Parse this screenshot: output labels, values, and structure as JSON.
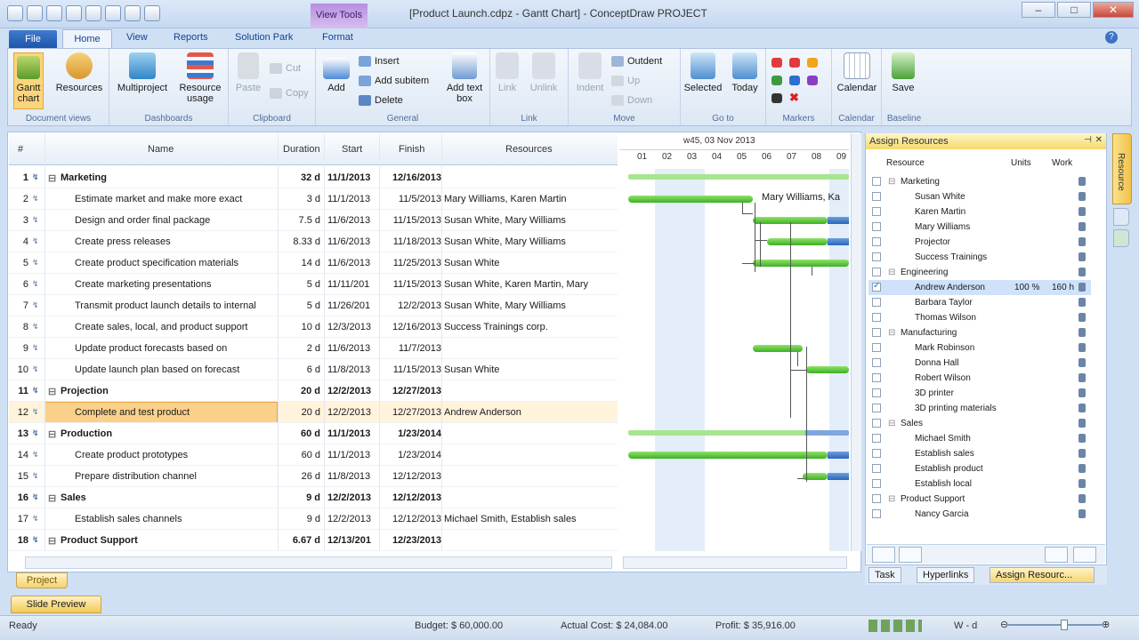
{
  "title_bar": {
    "title": "[Product Launch.cdpz - Gantt Chart] - ConceptDraw PROJECT",
    "context_tab": "View Tools",
    "min": "–",
    "max": "□",
    "close": "✕"
  },
  "tabs": {
    "file": "File",
    "home": "Home",
    "view": "View",
    "reports": "Reports",
    "solution_park": "Solution Park",
    "format": "Format"
  },
  "ribbon": {
    "document_views": {
      "label": "Document views",
      "gantt": "Gantt\nchart",
      "resources": "Resources"
    },
    "dashboards": {
      "label": "Dashboards",
      "multiproject": "Multiproject",
      "resource_usage": "Resource\nusage"
    },
    "clipboard": {
      "label": "Clipboard",
      "paste": "Paste",
      "cut": "Cut",
      "copy": "Copy"
    },
    "general": {
      "label": "General",
      "add": "Add",
      "insert": "Insert",
      "add_subitem": "Add subitem",
      "delete": "Delete",
      "add_text_box": "Add text\nbox"
    },
    "link": {
      "label": "Link",
      "link": "Link",
      "unlink": "Unlink"
    },
    "move": {
      "label": "Move",
      "indent": "Indent",
      "outdent": "Outdent",
      "up": "Up",
      "down": "Down"
    },
    "goto": {
      "label": "Go to",
      "selected": "Selected",
      "today": "Today"
    },
    "markers": {
      "label": "Markers"
    },
    "calendar": {
      "label": "Calendar",
      "calendar": "Calendar"
    },
    "baseline": {
      "label": "Baseline",
      "save": "Save"
    }
  },
  "grid": {
    "headers": {
      "num": "#",
      "name": "Name",
      "duration": "Duration",
      "start": "Start",
      "finish": "Finish",
      "resources": "Resources"
    },
    "rows": [
      {
        "n": "1",
        "name": "Marketing",
        "dur": "32 d",
        "start": "11/1/2013",
        "finish": "12/16/2013",
        "res": "",
        "summary": true
      },
      {
        "n": "2",
        "name": "Estimate market and make more exact",
        "dur": "3 d",
        "start": "11/1/2013",
        "finish": "11/5/2013",
        "res": "Mary Williams, Karen Martin"
      },
      {
        "n": "3",
        "name": "Design and order final package",
        "dur": "7.5 d",
        "start": "11/6/2013",
        "finish": "11/15/2013",
        "res": "Susan White, Mary Williams"
      },
      {
        "n": "4",
        "name": "Create press releases",
        "dur": "8.33 d",
        "start": "11/6/2013",
        "finish": "11/18/2013",
        "res": "Susan White, Mary Williams"
      },
      {
        "n": "5",
        "name": "Create product specification materials",
        "dur": "14 d",
        "start": "11/6/2013",
        "finish": "11/25/2013",
        "res": "Susan White"
      },
      {
        "n": "6",
        "name": "Create marketing presentations",
        "dur": "5 d",
        "start": "11/11/201",
        "finish": "11/15/2013",
        "res": "Susan White, Karen Martin, Mary"
      },
      {
        "n": "7",
        "name": "Transmit product launch details to internal",
        "dur": "5 d",
        "start": "11/26/201",
        "finish": "12/2/2013",
        "res": "Susan White, Mary Williams"
      },
      {
        "n": "8",
        "name": "Create sales, local, and product support",
        "dur": "10 d",
        "start": "12/3/2013",
        "finish": "12/16/2013",
        "res": "Success Trainings corp."
      },
      {
        "n": "9",
        "name": "Update product forecasts based on",
        "dur": "2 d",
        "start": "11/6/2013",
        "finish": "11/7/2013",
        "res": ""
      },
      {
        "n": "10",
        "name": "Update launch plan based on forecast",
        "dur": "6 d",
        "start": "11/8/2013",
        "finish": "11/15/2013",
        "res": "Susan White"
      },
      {
        "n": "11",
        "name": "Projection",
        "dur": "20 d",
        "start": "12/2/2013",
        "finish": "12/27/2013",
        "res": "",
        "summary": true
      },
      {
        "n": "12",
        "name": "Complete and test product",
        "dur": "20 d",
        "start": "12/2/2013",
        "finish": "12/27/2013",
        "res": "Andrew Anderson",
        "selected": true
      },
      {
        "n": "13",
        "name": "Production",
        "dur": "60 d",
        "start": "11/1/2013",
        "finish": "1/23/2014",
        "res": "",
        "summary": true
      },
      {
        "n": "14",
        "name": "Create product prototypes",
        "dur": "60 d",
        "start": "11/1/2013",
        "finish": "1/23/2014",
        "res": ""
      },
      {
        "n": "15",
        "name": "Prepare distribution channel",
        "dur": "26 d",
        "start": "11/8/2013",
        "finish": "12/12/2013",
        "res": ""
      },
      {
        "n": "16",
        "name": "Sales",
        "dur": "9 d",
        "start": "12/2/2013",
        "finish": "12/12/2013",
        "res": "",
        "summary": true
      },
      {
        "n": "17",
        "name": "Establish sales channels",
        "dur": "9 d",
        "start": "12/2/2013",
        "finish": "12/12/2013",
        "res": "Michael Smith, Establish sales"
      },
      {
        "n": "18",
        "name": "Product Support",
        "dur": "6.67 d",
        "start": "12/13/201",
        "finish": "12/23/2013",
        "res": "",
        "summary": true
      }
    ]
  },
  "gantt": {
    "week_label": "w45, 03 Nov 2013",
    "days": [
      "01",
      "02",
      "03",
      "04",
      "05",
      "06",
      "07",
      "08",
      "09"
    ],
    "row2_label": "Mary Williams, Ka"
  },
  "assign": {
    "title": "Assign Resources",
    "headers": {
      "resource": "Resource",
      "units": "Units",
      "work": "Work"
    },
    "items": [
      {
        "name": "Marketing",
        "group": true
      },
      {
        "name": "Susan White"
      },
      {
        "name": "Karen Martin"
      },
      {
        "name": "Mary Williams"
      },
      {
        "name": "Projector"
      },
      {
        "name": "Success Trainings"
      },
      {
        "name": "Engineering",
        "group": true
      },
      {
        "name": "Andrew Anderson",
        "units": "100 %",
        "work": "160 h",
        "checked": true
      },
      {
        "name": "Barbara Taylor"
      },
      {
        "name": "Thomas Wilson"
      },
      {
        "name": "Manufacturing",
        "group": true
      },
      {
        "name": "Mark Robinson"
      },
      {
        "name": "Donna Hall"
      },
      {
        "name": "Robert Wilson"
      },
      {
        "name": "3D printer"
      },
      {
        "name": "3D printing materials"
      },
      {
        "name": "Sales",
        "group": true
      },
      {
        "name": "Michael Smith"
      },
      {
        "name": "Establish sales"
      },
      {
        "name": "Establish product"
      },
      {
        "name": "Establish local"
      },
      {
        "name": "Product Support",
        "group": true
      },
      {
        "name": "Nancy Garcia"
      }
    ],
    "side_tab": "Resource",
    "bottom_tabs": [
      "Task",
      "Hyperlinks",
      "Assign Resourc..."
    ]
  },
  "bottom": {
    "project_tab": "Project",
    "slide_preview": "Slide Preview",
    "status": "Ready",
    "budget": "Budget: $ 60,000.00",
    "actual_cost": "Actual Cost: $ 24,084.00",
    "profit": "Profit: $ 35,916.00",
    "scale": "W - d"
  }
}
